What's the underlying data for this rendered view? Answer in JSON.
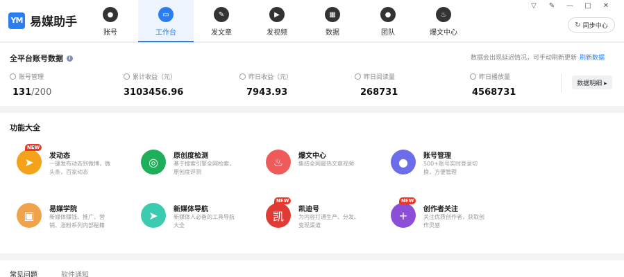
{
  "app": {
    "logo_mark": "YM",
    "title": "易媒助手"
  },
  "nav": [
    {
      "label": "账号",
      "icon": "user-icon",
      "glyph": "●"
    },
    {
      "label": "工作台",
      "icon": "monitor-icon",
      "glyph": "▭"
    },
    {
      "label": "发文章",
      "icon": "feather-icon",
      "glyph": "✎"
    },
    {
      "label": "发视频",
      "icon": "play-icon",
      "glyph": "▶"
    },
    {
      "label": "数据",
      "icon": "chart-icon",
      "glyph": "▦"
    },
    {
      "label": "团队",
      "icon": "team-icon",
      "glyph": "●"
    },
    {
      "label": "爆文中心",
      "icon": "fire-icon",
      "glyph": "♨"
    }
  ],
  "nav_active": 1,
  "window_controls": {
    "dropdown": "▽",
    "edit": "✎",
    "minimize": "—",
    "maximize": "□",
    "close": "✕"
  },
  "sync": {
    "label": "同步中心",
    "glyph": "↻"
  },
  "stats": {
    "title": "全平台账号数据",
    "info_glyph": "i",
    "hint": "数据会出现延迟情况，可手动刷新更新",
    "refresh_label": "刷新数据",
    "items": [
      {
        "label": "账号管理",
        "value": "131",
        "total": "/200",
        "icon": "user-icon"
      },
      {
        "label": "累计收益（元）",
        "value": "3103456.96",
        "icon": "wallet-icon"
      },
      {
        "label": "昨日收益（元）",
        "value": "7943.93",
        "icon": "coin-icon"
      },
      {
        "label": "昨日阅读量",
        "value": "268731",
        "icon": "eye-icon"
      },
      {
        "label": "昨日播放量",
        "value": "4568731",
        "icon": "play-circle-icon"
      }
    ],
    "detail_label": "数据明细 ▸"
  },
  "features": {
    "title": "功能大全",
    "items": [
      {
        "name": "发动态",
        "desc": "一键发布动态到微博，微头条，百家动态",
        "badge": "NEW",
        "color": "#f5a21b",
        "icon": "paper-plane-icon",
        "glyph": "➤"
      },
      {
        "name": "原创度检测",
        "desc": "基于搜索引擎全网检索，原创度评测",
        "badge": "",
        "color": "#1fae5a",
        "icon": "radar-icon",
        "glyph": "◎"
      },
      {
        "name": "爆文中心",
        "desc": "集结全网最热文章视频",
        "badge": "",
        "color": "#ef5a5a",
        "icon": "fire-icon",
        "glyph": "♨"
      },
      {
        "name": "账号管理",
        "desc": "500+账号实时登录切换，方便管理",
        "badge": "",
        "color": "#6b6ee8",
        "icon": "user-icon",
        "glyph": "●"
      },
      {
        "name": "易媒学院",
        "desc": "新媒体赚钱、推广、营销、涨粉系列内部秘籍",
        "badge": "",
        "color": "#f0a34a",
        "icon": "owl-icon",
        "glyph": "▣"
      },
      {
        "name": "新媒体导航",
        "desc": "新媒体人必备的工具导航大全",
        "badge": "",
        "color": "#3ccab0",
        "icon": "navigation-icon",
        "glyph": "➤"
      },
      {
        "name": "凯迪号",
        "desc": "为内容打通生产、分发、变现渠道",
        "badge": "NEW",
        "color": "#e03b35",
        "icon": "kaidi-icon",
        "glyph": "凯"
      },
      {
        "name": "创作者关注",
        "desc": "关注优质创作者，获取创作灵感",
        "badge": "NEW",
        "color": "#8a4fd6",
        "icon": "add-user-icon",
        "glyph": "+"
      }
    ]
  },
  "bottom": {
    "tab1": "常见问题",
    "tab2": "软件通知"
  }
}
